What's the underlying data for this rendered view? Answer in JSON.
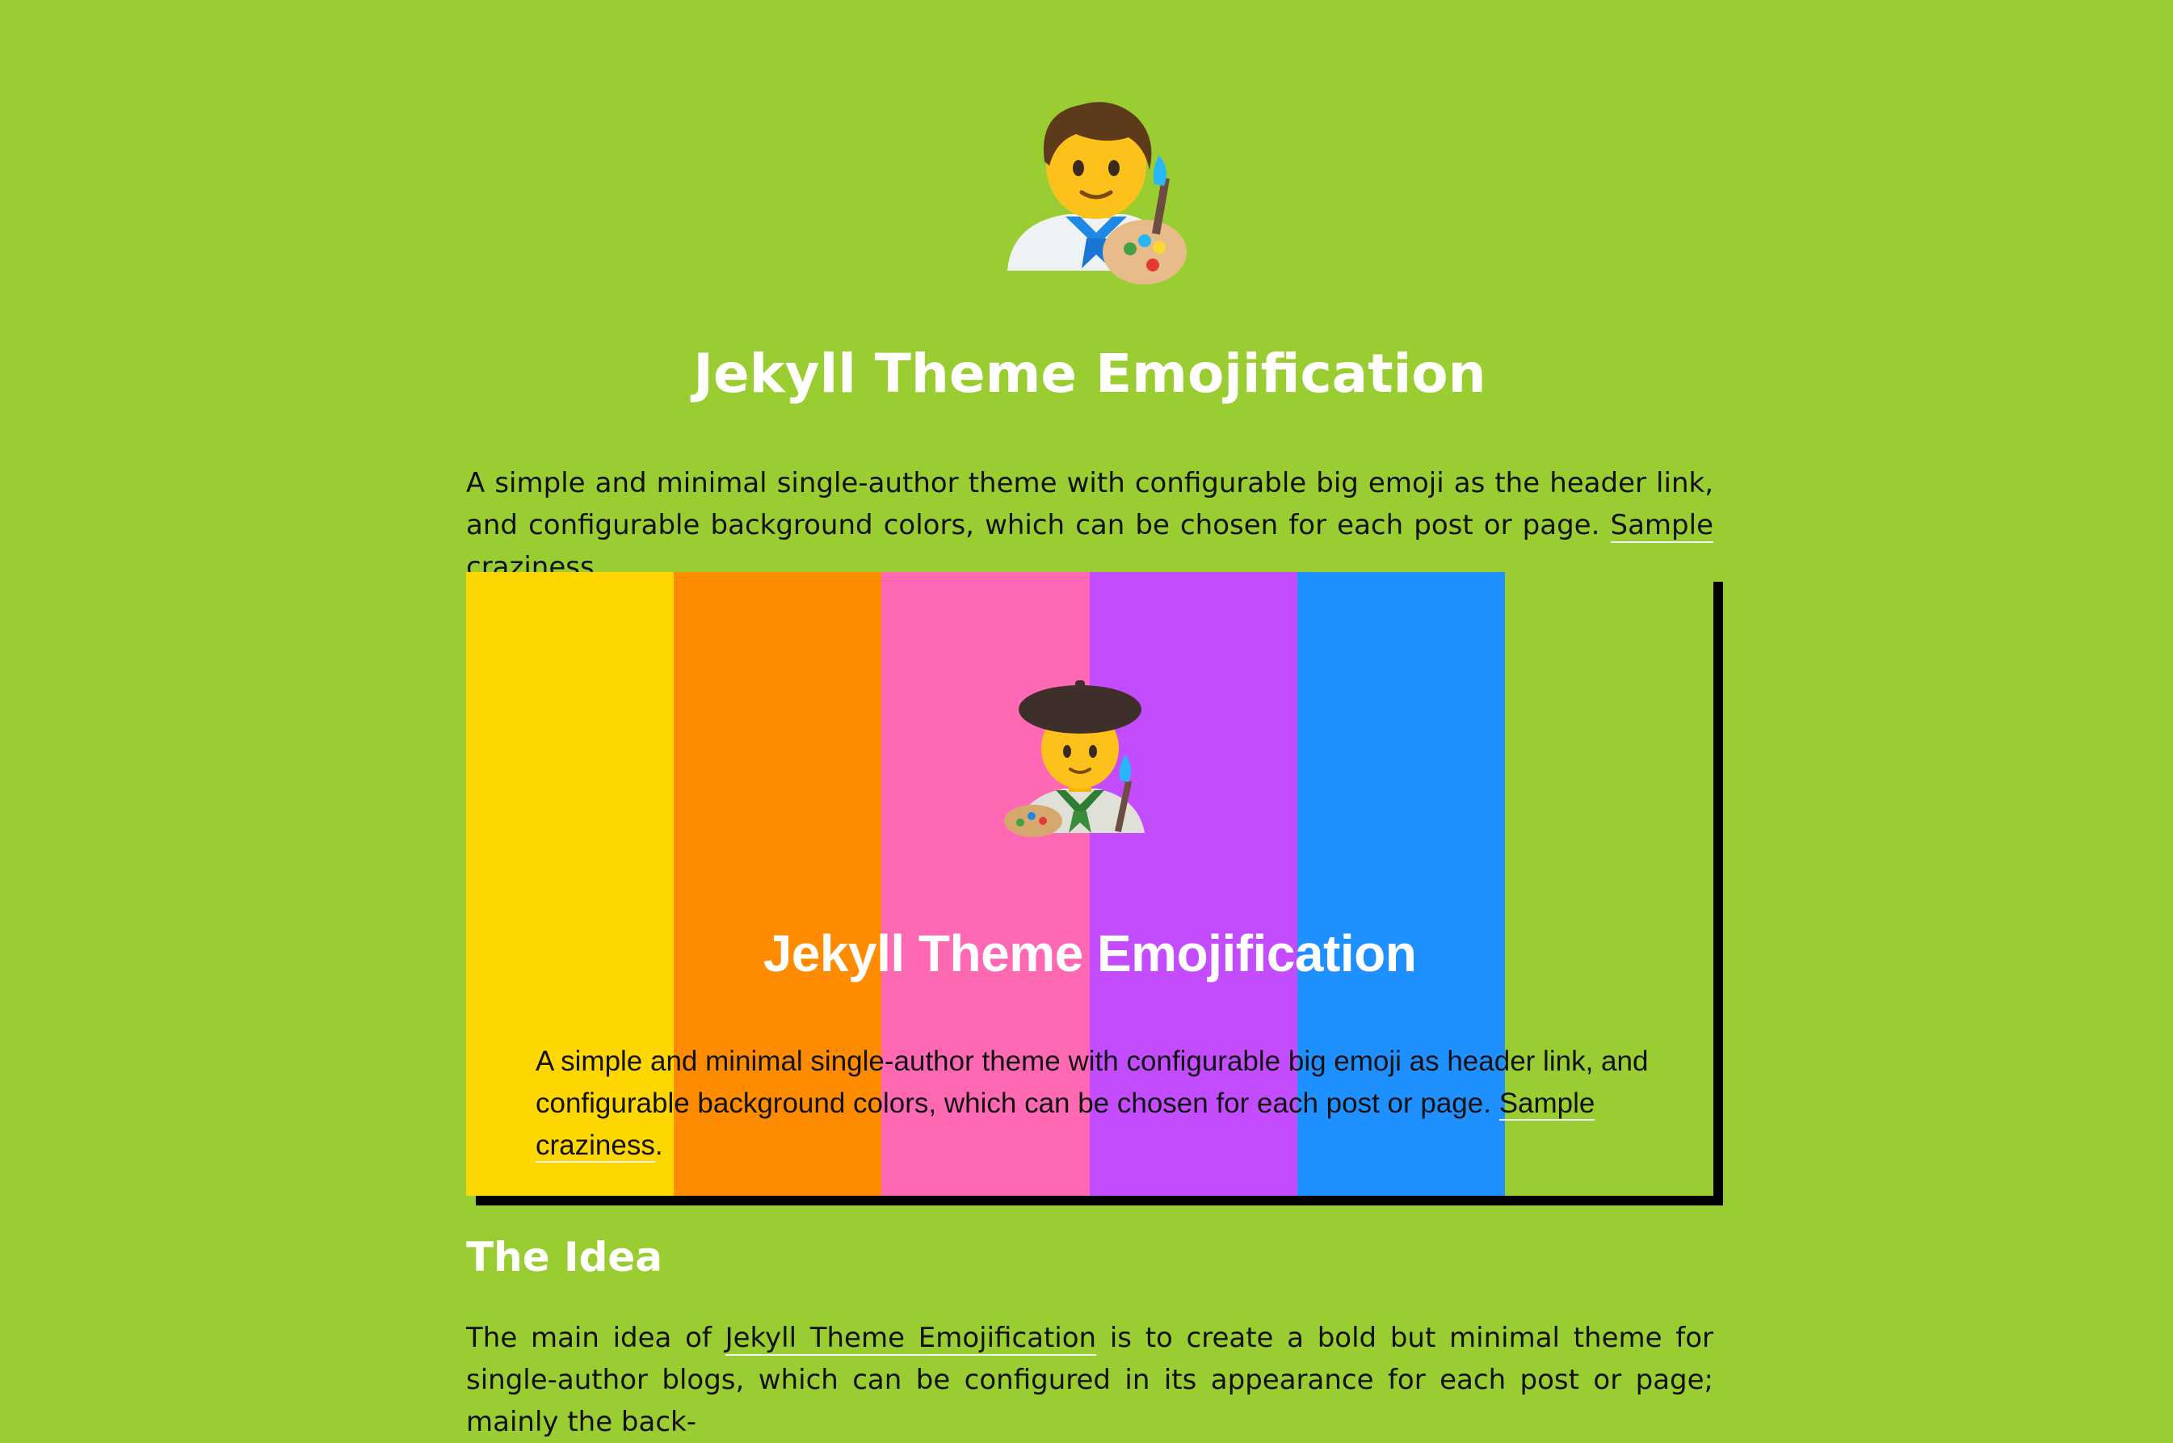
{
  "header": {
    "logo_icon": "artist-emoji-icon",
    "title": "Jekyll Theme Emojification"
  },
  "intro": {
    "text": "A simple and minimal single-author theme with configurable big emoji as the header link, and configurable background colors, which can be chosen for each post or page. ",
    "link_label": "Sample craziness",
    "after": "."
  },
  "screenshot": {
    "stripe_colors": [
      "#ffd700",
      "#ff8c00",
      "#ff69b4",
      "#c44cff",
      "#1e90ff"
    ],
    "emoji_icon": "artist-with-beret-emoji-icon",
    "title": "Jekyll Theme Emojification",
    "text": "A simple and minimal single-author theme with configurable big emoji as header link, and configurable background colors, which can be chosen for each post or page. ",
    "link_label": "Sample craziness",
    "after": "."
  },
  "section": {
    "heading": "The Idea",
    "text_before": "The main idea of ",
    "link_label": "Jekyll Theme Emojification",
    "text_after": " is to create a bold but minimal theme for single-author blogs, which can be configured in its appearance for each post or page; mainly the back-"
  },
  "colors": {
    "background": "#9acd32",
    "title": "#ffffff",
    "text": "#111111",
    "shadow": "#000000"
  }
}
